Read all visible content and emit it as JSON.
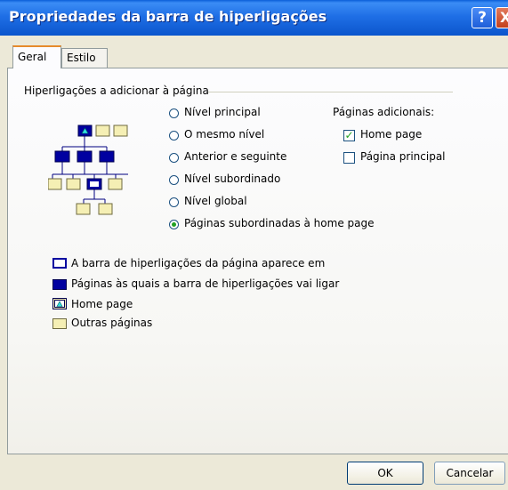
{
  "window": {
    "title": "Propriedades da barra de hiperligações"
  },
  "titlebar_buttons": {
    "help": "?",
    "close": "X"
  },
  "tabs": [
    {
      "label": "Geral",
      "active": true
    },
    {
      "label": "Estilo",
      "active": false
    }
  ],
  "group": {
    "title": "Hiperligações a adicionar à página"
  },
  "radio_options": [
    {
      "label": "Nível principal",
      "selected": false
    },
    {
      "label": "O mesmo nível",
      "selected": false
    },
    {
      "label": "Anterior e seguinte",
      "selected": false
    },
    {
      "label": "Nível subordinado",
      "selected": false
    },
    {
      "label": "Nível global",
      "selected": false
    },
    {
      "label": "Páginas subordinadas à home page",
      "selected": true
    }
  ],
  "additional_pages": {
    "title": "Páginas adicionais:",
    "options": [
      {
        "label": "Home page",
        "checked": true
      },
      {
        "label": "Página principal",
        "checked": false
      }
    ]
  },
  "legend": [
    {
      "label": "A barra de hiperligações da página aparece em",
      "icon": "current-page-icon"
    },
    {
      "label": "Páginas às quais a barra de hiperligações vai ligar",
      "icon": "linked-page-icon"
    },
    {
      "label": "Home page",
      "icon": "home-page-icon"
    },
    {
      "label": "Outras páginas",
      "icon": "other-page-icon"
    }
  ],
  "colors": {
    "linked": "#0000a0",
    "other": "#f5efb4",
    "titlebar": "#0b55cc"
  },
  "buttons": {
    "ok": "OK",
    "cancel": "Cancelar"
  }
}
